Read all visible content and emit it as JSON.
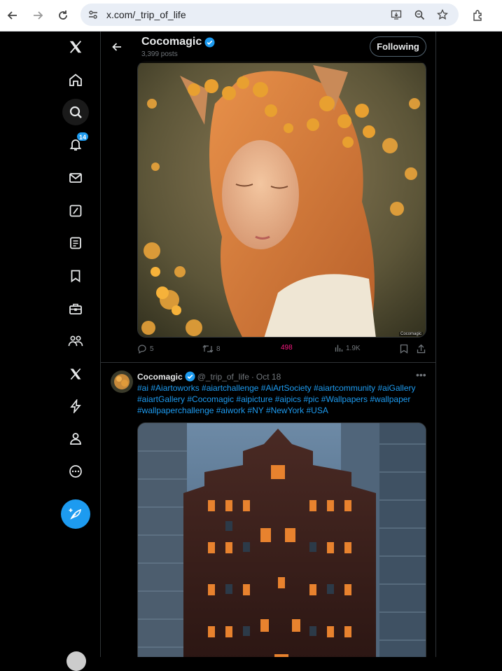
{
  "browser": {
    "url": "x.com/_trip_of_life",
    "icons": [
      "back-arrow-icon",
      "forward-arrow-icon",
      "reload-icon",
      "site-info-icon",
      "install-app-icon",
      "zoom-icon",
      "bookmark-star-icon",
      "extensions-icon"
    ]
  },
  "sidebar": {
    "notifications_badge": "14",
    "items": [
      "x-logo",
      "home",
      "explore",
      "notifications",
      "messages",
      "grok",
      "lists",
      "bookmarks",
      "jobs",
      "communities",
      "premium",
      "verified-orgs",
      "profile",
      "more",
      "post"
    ]
  },
  "header": {
    "name": "Cocomagic",
    "posts": "3,399 posts",
    "follow_label": "Following"
  },
  "tweet1": {
    "image_caption": "Cocomagic",
    "replies": "5",
    "reposts": "8",
    "likes": "498",
    "views": "1.9K"
  },
  "tweet2": {
    "name": "Cocomagic",
    "handle": "@_trip_of_life",
    "separator": "·",
    "date": "Oct 18",
    "text": "#ai #Aiartoworks #aiartchallenge #AiArtSociety #aiartcommunity #aiGallery #aiartGallery #Cocomagic #aipicture #aipics #pic #Wallpapers #wallpaper #wallpaperchallenge #aiwork #NY #NewYork #USA"
  },
  "colors": {
    "accent": "#1d9bf0",
    "like": "#f91880",
    "text": "#e7e9ea",
    "muted": "#71767b",
    "border": "#2f3336"
  }
}
